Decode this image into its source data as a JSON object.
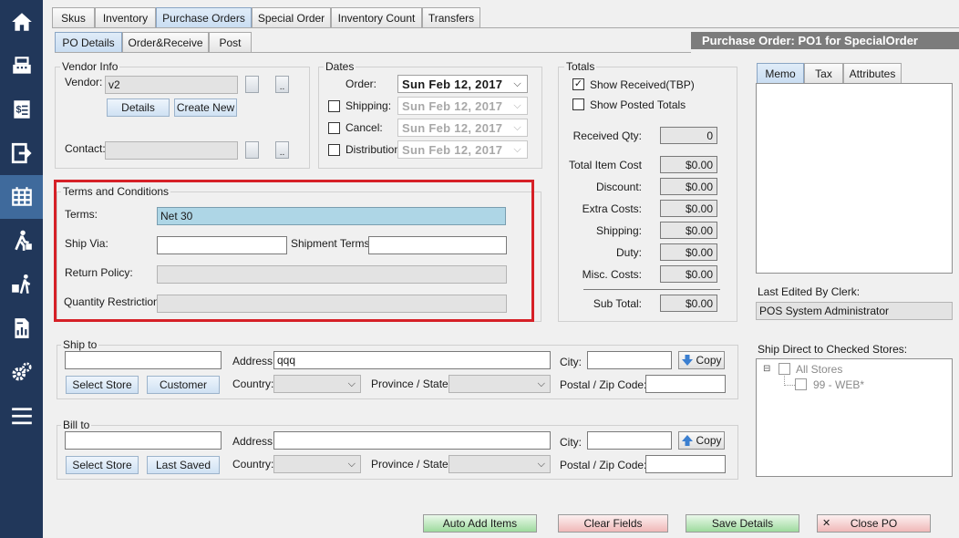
{
  "sidebar": {
    "items": [
      {
        "name": "home-icon"
      },
      {
        "name": "register-icon"
      },
      {
        "name": "receipt-icon"
      },
      {
        "name": "logout-icon"
      },
      {
        "name": "inventory-grid-icon"
      },
      {
        "name": "customer-walk-icon"
      },
      {
        "name": "delivery-icon"
      },
      {
        "name": "report-icon"
      },
      {
        "name": "settings-gears-icon"
      },
      {
        "name": "menu-icon"
      }
    ]
  },
  "top_tabs": [
    "Skus",
    "Inventory",
    "Purchase Orders",
    "Special Order",
    "Inventory Count",
    "Transfers"
  ],
  "sub_tabs": [
    "PO Details",
    "Order&Receive",
    "Post"
  ],
  "title": "Purchase Order:  PO1 for SpecialOrder",
  "vendor_info": {
    "group": "Vendor Info",
    "vendor_label": "Vendor:",
    "vendor_value": "v2",
    "details_btn": "Details",
    "create_new_btn": "Create New",
    "contact_label": "Contact:",
    "contact_value": "",
    "dots": ".."
  },
  "dates": {
    "group": "Dates",
    "order_label": "Order:",
    "order_value": "Sun  Feb 12, 2017",
    "shipping_label": "Shipping:",
    "shipping_value": "Sun  Feb 12, 2017",
    "cancel_label": "Cancel:",
    "cancel_value": "Sun  Feb 12, 2017",
    "distribution_label": "Distribution:",
    "distribution_value": "Sun  Feb 12, 2017",
    "chevron": "⌵"
  },
  "totals": {
    "group": "Totals",
    "show_received": "Show Received(TBP)",
    "show_received_checked": "✓",
    "show_posted": "Show Posted Totals",
    "received_qty_label": "Received Qty:",
    "received_qty_value": "0",
    "rows": [
      {
        "label": "Total Item Cost",
        "value": "$0.00"
      },
      {
        "label": "Discount:",
        "value": "$0.00"
      },
      {
        "label": "Extra Costs:",
        "value": "$0.00"
      },
      {
        "label": "Shipping:",
        "value": "$0.00"
      },
      {
        "label": "Duty:",
        "value": "$0.00"
      },
      {
        "label": "Misc. Costs:",
        "value": "$0.00"
      }
    ],
    "subtotal_label": "Sub Total:",
    "subtotal_value": "$0.00"
  },
  "terms": {
    "group": "Terms and Conditions",
    "terms_label": "Terms:",
    "terms_value": "Net 30",
    "ship_via_label": "Ship Via:",
    "ship_via_value": "",
    "shipment_terms_label": "Shipment Terms:",
    "shipment_terms_value": "",
    "return_policy_label": "Return Policy:",
    "return_policy_value": "",
    "qty_restriction_label": "Quantity Restriction:",
    "qty_restriction_value": ""
  },
  "ship_to": {
    "group": "Ship to",
    "name_value": "",
    "address_label": "Address:",
    "address_value": "qqq",
    "city_label": "City:",
    "city_value": "",
    "copy_btn": "Copy",
    "select_store_btn": "Select Store",
    "customer_btn": "Customer",
    "country_label": "Country:",
    "province_label": "Province / State:",
    "postal_label": "Postal / Zip Code:",
    "postal_value": ""
  },
  "bill_to": {
    "group": "Bill to",
    "name_value": "",
    "address_label": "Address:",
    "address_value": "",
    "city_label": "City:",
    "city_value": "",
    "copy_btn": "Copy",
    "select_store_btn": "Select Store",
    "last_saved_btn": "Last Saved",
    "country_label": "Country:",
    "province_label": "Province / State:",
    "postal_label": "Postal / Zip Code:",
    "postal_value": ""
  },
  "right_panel": {
    "tabs": [
      "Memo",
      "Tax",
      "Attributes"
    ],
    "memo_value": "",
    "last_edited_label": "Last Edited By Clerk:",
    "last_edited_value": "POS System Administrator",
    "ship_direct_label": "Ship Direct to Checked Stores:",
    "tree_expander": "⊟",
    "tree_root": "All Stores",
    "tree_child": "99 - WEB*"
  },
  "bottom_buttons": {
    "auto_add": "Auto Add Items",
    "clear_fields": "Clear Fields",
    "save_details": "Save Details",
    "close_po": "Close PO",
    "close_glyph": "✕"
  },
  "colors": {
    "sidebar_bg": "#21375a",
    "sidebar_active": "#3f6a9c",
    "highlight_border": "#d62027",
    "terms_fill": "#aed6e6",
    "title_bar": "#7c7c7c"
  }
}
